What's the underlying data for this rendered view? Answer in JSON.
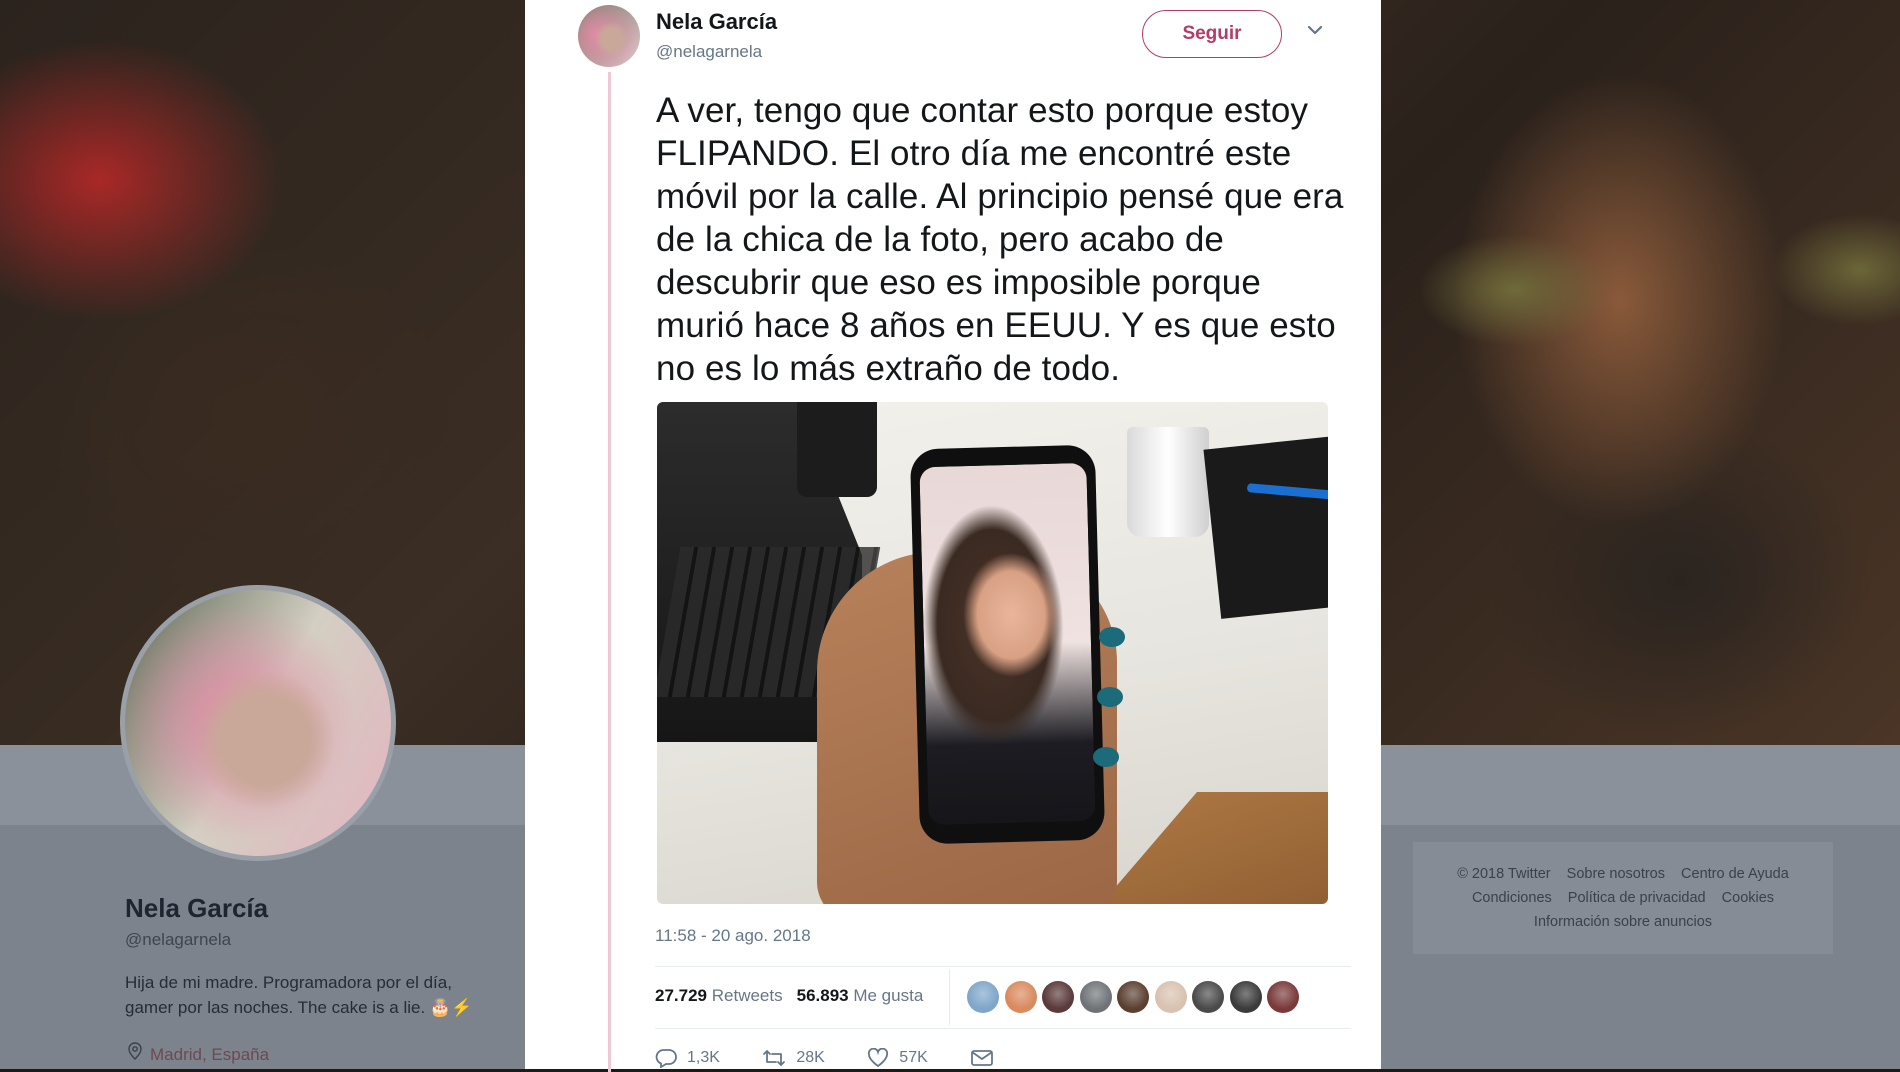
{
  "profile": {
    "name": "Nela García",
    "handle": "@nelagarnela",
    "bio": "Hija de mi madre. Programadora por el día, gamer por las noches. The cake is a lie. 🎂⚡",
    "location": "Madrid, España"
  },
  "footer": {
    "links": [
      "© 2018 Twitter",
      "Sobre nosotros",
      "Centro de Ayuda",
      "Condiciones",
      "Política de privacidad",
      "Cookies",
      "Información sobre anuncios"
    ]
  },
  "tweet": {
    "author_name": "Nela García",
    "author_handle": "@nelagarnela",
    "follow_label": "Seguir",
    "text": "A ver, tengo que contar esto porque estoy FLIPANDO. El otro día me encontré este móvil por la calle. Al principio pensé que era de la chica de la foto, pero acabo de descubrir que eso es imposible porque murió hace 8 años en EEUU. Y es que esto no es lo más extraño de todo.",
    "timestamp": "11:58 - 20 ago. 2018",
    "retweets_count": "27.729",
    "retweets_label": "Retweets",
    "likes_count": "56.893",
    "likes_label": "Me gusta",
    "liker_colors": [
      "#7fa6c9",
      "#d98a5e",
      "#5a3a3a",
      "#6f7377",
      "#5b4030",
      "#d8c2b0",
      "#4a4a4a",
      "#3b3b3b",
      "#7a3a3a"
    ],
    "actions": {
      "reply_count": "1,3K",
      "retweet_count": "28K",
      "like_count": "57K"
    }
  },
  "colors": {
    "accent": "#b23c6a",
    "thread_line": "#f0c7d4"
  }
}
